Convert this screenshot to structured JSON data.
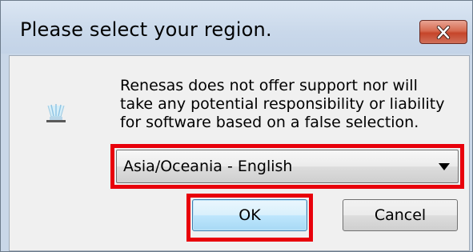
{
  "dialog": {
    "title": "Please select your region.",
    "message_lines": [
      "Renesas does not offer support nor will",
      "take any potential responsibility or liability",
      "for software based on a false selection."
    ],
    "region_select": {
      "selected_value": "Asia/Oceania - English"
    },
    "buttons": {
      "ok_label": "OK",
      "cancel_label": "Cancel"
    },
    "icons": {
      "close": "close-icon",
      "app": "app-icon",
      "dropdown": "chevron-down-icon"
    },
    "colors": {
      "highlight": "#e8000b",
      "close_button": "#c6452a",
      "ok_button": "#bee6fd"
    }
  }
}
